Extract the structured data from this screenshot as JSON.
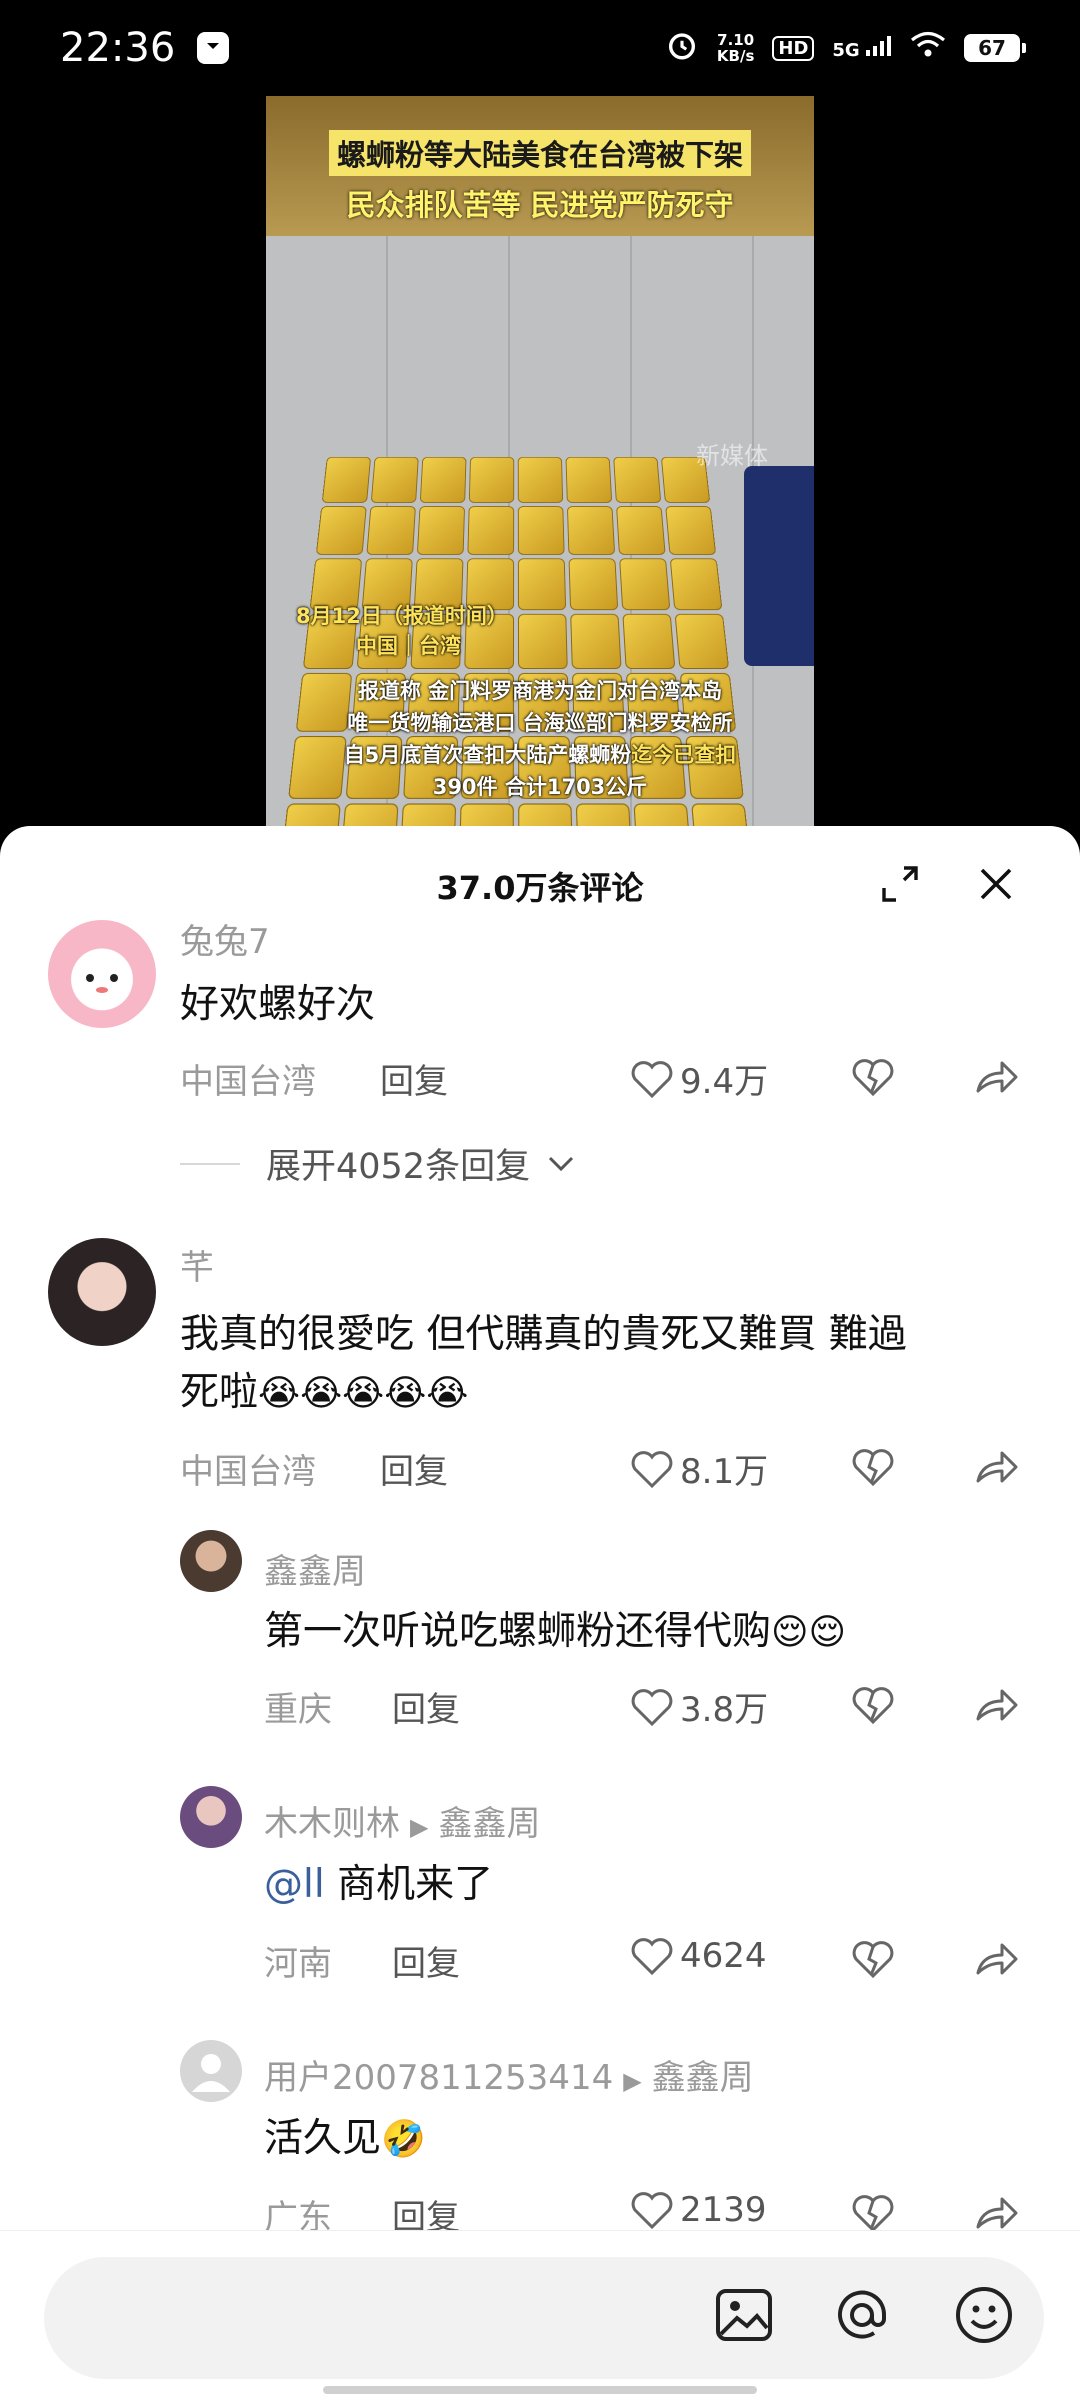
{
  "status_bar": {
    "time": "22:36",
    "speed_value": "7.10",
    "speed_unit": "KB/s",
    "hd": "HD",
    "network": "5G",
    "battery": "67"
  },
  "video": {
    "headline_line1": "螺蛳粉等大陆美食在台湾被下架",
    "headline_line2": "民众排队苦等 民进党严防死守",
    "caption_date": "8月12日（报道时间）",
    "caption_location": "中国｜台湾",
    "caption_body_line1": "报道称 金门料罗商港为金门对台湾本岛",
    "caption_body_line2": "唯一货物输运港口 台海巡部门料罗安检所",
    "caption_body_line3": "自5月底首次查扣大陆产螺蛳粉",
    "caption_body_line3_highlight": "迄今已查扣",
    "caption_body_line4": "390件 合计1703公斤",
    "watermark": "新媒体"
  },
  "comments_panel": {
    "count_label": "37.0万条评论",
    "expand_replies_label": "展开4052条回复"
  },
  "comments": [
    {
      "username": "兔兔7",
      "text": "好欢螺好次",
      "location": "中国台湾",
      "reply_label": "回复",
      "likes": "9.4万"
    },
    {
      "username": "芊",
      "text_line1": "我真的很愛吃 但代購真的貴死又難買 難過",
      "text_line2": "死啦",
      "location": "中国台湾",
      "reply_label": "回复",
      "likes": "8.1万"
    },
    {
      "username": "鑫鑫周",
      "text": "第一次听说吃螺蛳粉还得代购",
      "location": "重庆",
      "reply_label": "回复",
      "likes": "3.8万"
    },
    {
      "username": "木木则林",
      "reply_to": "鑫鑫周",
      "mention": "@ll",
      "text": " 商机来了",
      "location": "河南",
      "reply_label": "回复",
      "likes": "4624"
    },
    {
      "username": "用户2007811253414",
      "reply_to": "鑫鑫周",
      "text": "活久见",
      "location": "广东",
      "reply_label": "回复",
      "likes": "2139"
    }
  ],
  "colors": {
    "accent_yellow": "#ffe45a",
    "mention_blue": "#3a5f9a",
    "meta_gray": "#9a9a9a"
  }
}
